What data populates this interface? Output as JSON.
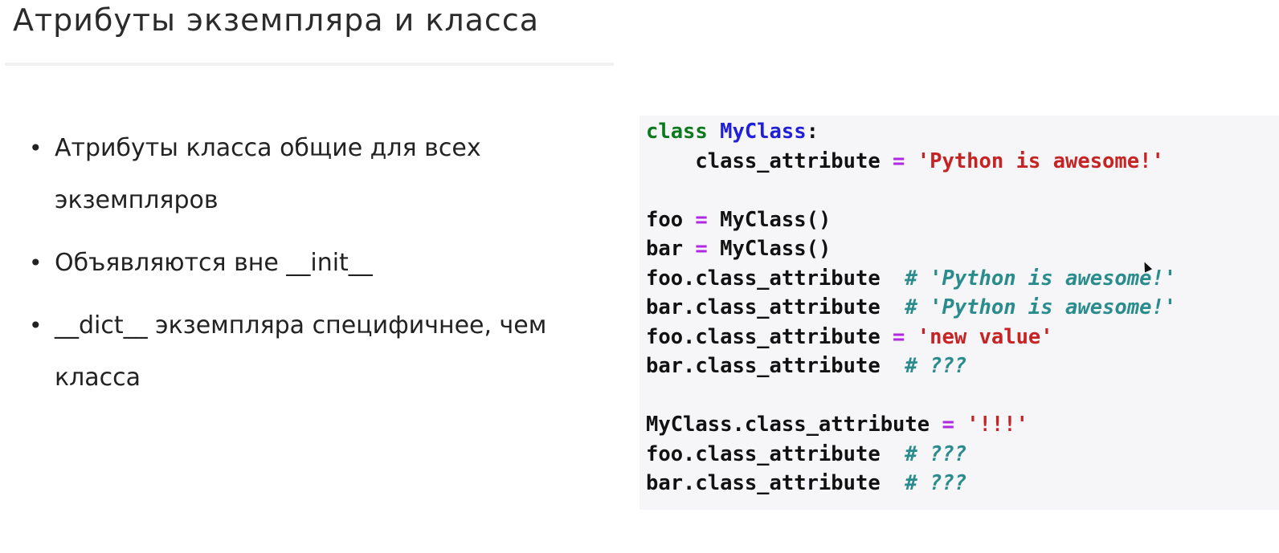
{
  "slide": {
    "title": "Атрибуты экземпляра и класса"
  },
  "bullets": [
    {
      "text": "Атрибуты класса общие для всех экземпляров"
    },
    {
      "text": "Объявляются вне __init__"
    },
    {
      "text": "__dict__ экземпляра специфичнее, чем класса"
    }
  ],
  "code": {
    "lines": [
      {
        "tokens": [
          {
            "t": "class",
            "k": "kw"
          },
          {
            "t": " ",
            "k": ""
          },
          {
            "t": "MyClass",
            "k": "cls"
          },
          {
            "t": ":",
            "k": ""
          }
        ]
      },
      {
        "tokens": [
          {
            "t": "    class_attribute ",
            "k": ""
          },
          {
            "t": "=",
            "k": "op"
          },
          {
            "t": " ",
            "k": ""
          },
          {
            "t": "'Python is awesome!'",
            "k": "str"
          }
        ]
      },
      {
        "tokens": []
      },
      {
        "tokens": [
          {
            "t": "foo ",
            "k": ""
          },
          {
            "t": "=",
            "k": "op"
          },
          {
            "t": " MyClass()",
            "k": ""
          }
        ]
      },
      {
        "tokens": [
          {
            "t": "bar ",
            "k": ""
          },
          {
            "t": "=",
            "k": "op"
          },
          {
            "t": " MyClass()",
            "k": ""
          }
        ]
      },
      {
        "tokens": [
          {
            "t": "foo.class_attribute  ",
            "k": ""
          },
          {
            "t": "# 'Python is awesome!'",
            "k": "cmt"
          }
        ]
      },
      {
        "tokens": [
          {
            "t": "bar.class_attribute  ",
            "k": ""
          },
          {
            "t": "# 'Python is awesome!'",
            "k": "cmt"
          }
        ]
      },
      {
        "tokens": [
          {
            "t": "foo.class_attribute ",
            "k": ""
          },
          {
            "t": "=",
            "k": "op"
          },
          {
            "t": " ",
            "k": ""
          },
          {
            "t": "'new value'",
            "k": "str"
          }
        ]
      },
      {
        "tokens": [
          {
            "t": "bar.class_attribute  ",
            "k": ""
          },
          {
            "t": "# ???",
            "k": "cmt"
          }
        ]
      },
      {
        "tokens": []
      },
      {
        "tokens": [
          {
            "t": "MyClass.class_attribute ",
            "k": ""
          },
          {
            "t": "=",
            "k": "op"
          },
          {
            "t": " ",
            "k": ""
          },
          {
            "t": "'!!!'",
            "k": "str"
          }
        ]
      },
      {
        "tokens": [
          {
            "t": "foo.class_attribute  ",
            "k": ""
          },
          {
            "t": "# ???",
            "k": "cmt"
          }
        ]
      },
      {
        "tokens": [
          {
            "t": "bar.class_attribute  ",
            "k": ""
          },
          {
            "t": "# ???",
            "k": "cmt"
          }
        ]
      }
    ]
  },
  "colors": {
    "keyword": "#0b7a1d",
    "class_name": "#2020d8",
    "operator": "#b028e0",
    "string": "#c62424",
    "comment": "#2a8c8c",
    "code_background": "#f6f5f7"
  },
  "icons": {
    "cursor": "mouse-pointer-icon"
  }
}
